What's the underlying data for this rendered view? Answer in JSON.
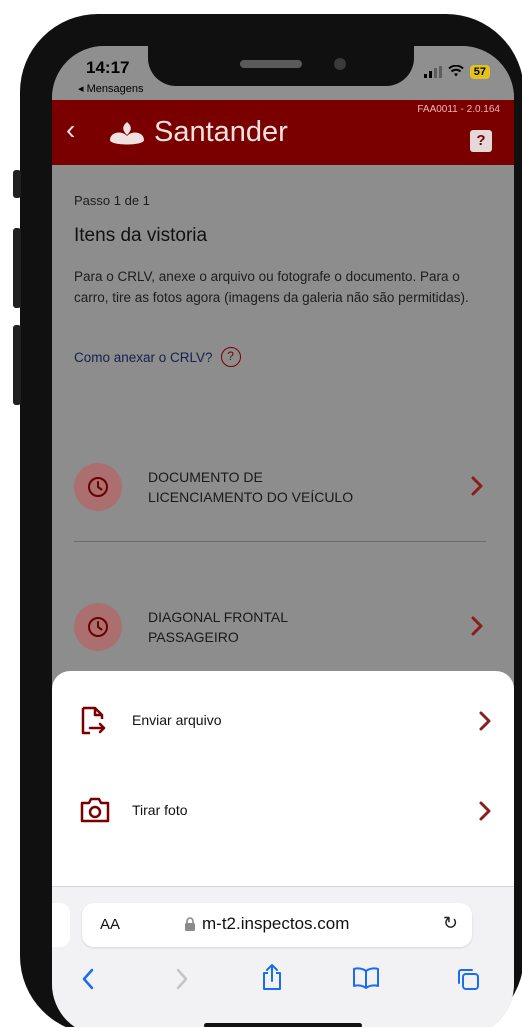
{
  "status_bar": {
    "time": "14:17",
    "back_app": "◂ Mensagens",
    "battery": "57"
  },
  "header": {
    "brand": "Santander",
    "version": "FAA0011 - 2.0.164",
    "help": "?"
  },
  "content": {
    "step": "Passo 1 de 1",
    "title": "Itens da vistoria",
    "description": "Para o CRLV, anexe o arquivo ou fotografe o documento. Para o carro, tire as fotos agora (imagens da galeria não são permitidas).",
    "how_to_link": "Como anexar o CRLV?",
    "items": [
      {
        "line1": "DOCUMENTO DE",
        "line2": "LICENCIAMENTO DO VEÍCULO"
      },
      {
        "line1": "DIAGONAL FRONTAL",
        "line2": "PASSAGEIRO"
      }
    ]
  },
  "sheet": {
    "send_file": "Enviar arquivo",
    "take_photo": "Tirar foto"
  },
  "browser": {
    "aa": "AA",
    "url": "m-t2.inspectos.com",
    "reload": "↻"
  },
  "colors": {
    "brand_red": "#7a0000",
    "chevron_red": "#8b1d1d"
  }
}
